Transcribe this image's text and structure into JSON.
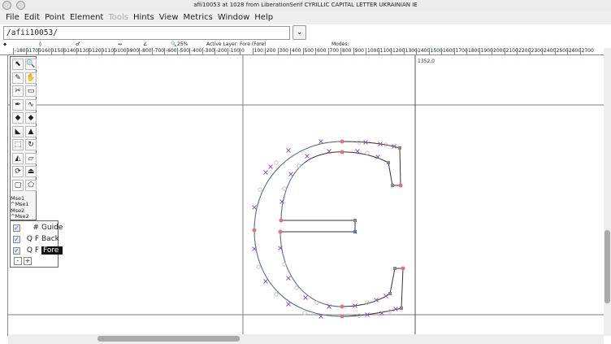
{
  "window": {
    "title": "afii10053 at 1028 from LiberationSerif CYRILLIC CAPITAL LETTER UKRAINIAN IE"
  },
  "menu": [
    {
      "label": "File"
    },
    {
      "label": "Edit"
    },
    {
      "label": "Point"
    },
    {
      "label": "Element"
    },
    {
      "label": "Tools",
      "disabled": true
    },
    {
      "label": "Hints"
    },
    {
      "label": "View"
    },
    {
      "label": "Metrics"
    },
    {
      "label": "Window"
    },
    {
      "label": "Help"
    }
  ],
  "glyph_field": {
    "value": "/afii10053/"
  },
  "infobar": {
    "zoom": "25%",
    "active_layer": "Active Layer: Fore (Fore)",
    "modes": "Modes:"
  },
  "ruler_ticks": [
    "-1800",
    "-1700",
    "-1600",
    "-1500",
    "-1400",
    "-1300",
    "-1200",
    "-1100",
    "-1000",
    "-900",
    "-800",
    "-700",
    "-600",
    "-500",
    "-400",
    "-300",
    "-200",
    "-100",
    "0",
    "100",
    "200",
    "300",
    "400",
    "500",
    "600",
    "700",
    "800",
    "900",
    "1000",
    "1100",
    "1200",
    "1300",
    "1400",
    "1500",
    "1600",
    "1700",
    "1800",
    "1900",
    "2000",
    "2100",
    "2200",
    "2300",
    "2400",
    "2500",
    "2600",
    "2700"
  ],
  "width_label": "1352,0",
  "tools": {
    "mse1": "Mse1",
    "cmse1": "^Mse1",
    "mse2": "Mse2",
    "cmse2": "^Mse2"
  },
  "layers": [
    {
      "flags": "#",
      "name": "Guide"
    },
    {
      "flags": "Q F",
      "name": "Back"
    },
    {
      "flags": "Q F",
      "name": "Fore",
      "selected": true
    }
  ],
  "layer_buttons": {
    "minus": "-",
    "plus": "+"
  },
  "colors": {
    "guide": "#808080",
    "oncurve": "#e57373",
    "offcurve": "#9c4fc0",
    "outline": "#333333"
  }
}
